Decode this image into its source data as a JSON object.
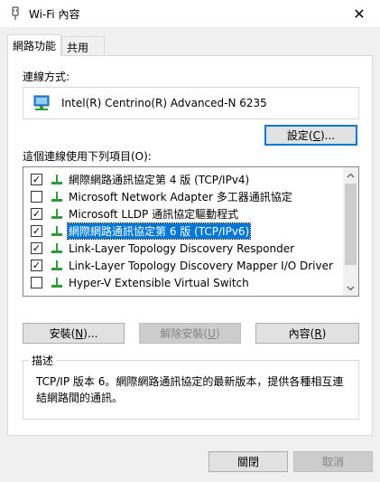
{
  "window": {
    "title": "Wi-Fi 內容",
    "close_glyph": "✕"
  },
  "tabs": [
    {
      "label": "網路功能",
      "active": true
    },
    {
      "label": "共用",
      "active": false
    }
  ],
  "connect": {
    "label": "連線方式:",
    "adapter_name": "Intel(R) Centrino(R) Advanced-N 6235",
    "configure_pre": "設定(",
    "configure_key": "C",
    "configure_post": ")..."
  },
  "items_label": "這個連線使用下列項目(O):",
  "items": [
    {
      "label": "網際網路通訊協定第 4 版 (TCP/IPv4)",
      "checked": true,
      "selected": false
    },
    {
      "label": "Microsoft Network Adapter 多工器通訊協定",
      "checked": false,
      "selected": false
    },
    {
      "label": "Microsoft LLDP 通訊協定驅動程式",
      "checked": true,
      "selected": false
    },
    {
      "label": "網際網路通訊協定第 6 版 (TCP/IPv6)",
      "checked": true,
      "selected": true
    },
    {
      "label": "Link-Layer Topology Discovery Responder",
      "checked": true,
      "selected": false
    },
    {
      "label": "Link-Layer Topology Discovery Mapper I/O Driver",
      "checked": true,
      "selected": false
    },
    {
      "label": "Hyper-V Extensible Virtual Switch",
      "checked": false,
      "selected": false
    }
  ],
  "check_glyph": "✓",
  "actions": {
    "install": {
      "pre": "安裝(",
      "key": "N",
      "post": ")..."
    },
    "uninstall": {
      "pre": "解除安裝(",
      "key": "U",
      "post": ")"
    },
    "properties": {
      "pre": "內容(",
      "key": "R",
      "post": ")"
    }
  },
  "description": {
    "title": "描述",
    "text": "TCP/IP 版本 6。網際網路通訊協定的最新版本，提供各種相互連結網路間的通訊。"
  },
  "footer": {
    "ok": "關閉",
    "cancel": "取消"
  },
  "colors": {
    "accent": "#0078d7",
    "network_icon": "#2e9c3a"
  }
}
